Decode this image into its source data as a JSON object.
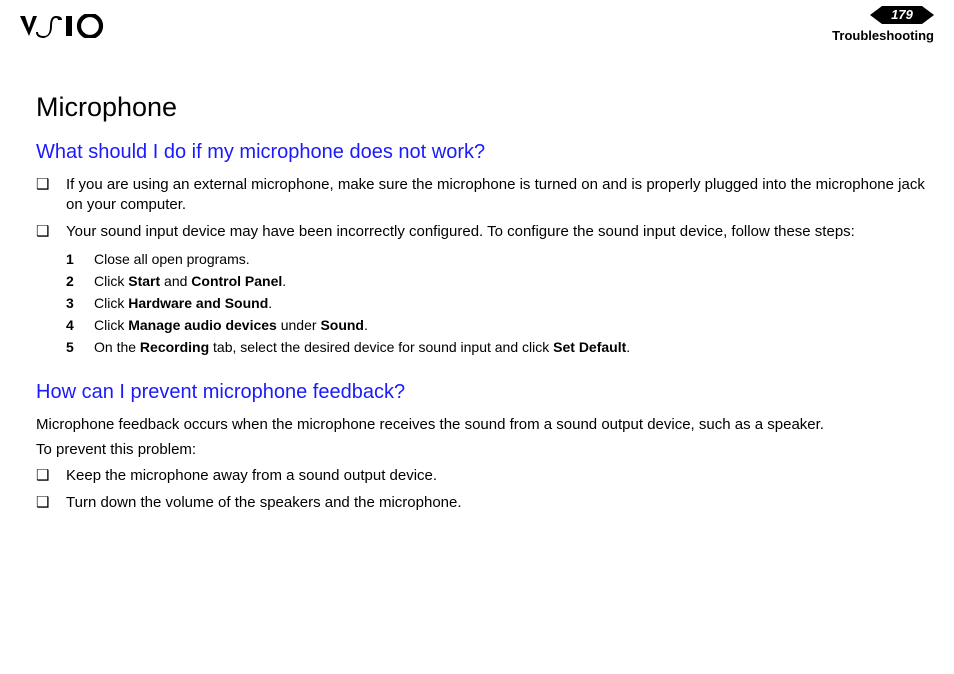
{
  "header": {
    "page_number": "179",
    "section": "Troubleshooting"
  },
  "main": {
    "title": "Microphone",
    "q1": {
      "heading": "What should I do if my microphone does not work?",
      "bullet1": "If you are using an external microphone, make sure the microphone is turned on and is properly plugged into the microphone jack on your computer.",
      "bullet2": "Your sound input device may have been incorrectly configured. To configure the sound input device, follow these steps:",
      "steps": {
        "s1_n": "1",
        "s1": "Close all open programs.",
        "s2_n": "2",
        "s2_pre": "Click ",
        "s2_b1": "Start",
        "s2_mid": " and ",
        "s2_b2": "Control Panel",
        "s2_post": ".",
        "s3_n": "3",
        "s3_pre": "Click ",
        "s3_b1": "Hardware and Sound",
        "s3_post": ".",
        "s4_n": "4",
        "s4_pre": "Click ",
        "s4_b1": "Manage audio devices",
        "s4_mid": " under ",
        "s4_b2": "Sound",
        "s4_post": ".",
        "s5_n": "5",
        "s5_pre": "On the ",
        "s5_b1": "Recording",
        "s5_mid": " tab, select the desired device for sound input and click ",
        "s5_b2": "Set Default",
        "s5_post": "."
      }
    },
    "q2": {
      "heading": "How can I prevent microphone feedback?",
      "p1": "Microphone feedback occurs when the microphone receives the sound from a sound output device, such as a speaker.",
      "p2": "To prevent this problem:",
      "bullet1": "Keep the microphone away from a sound output device.",
      "bullet2": "Turn down the volume of the speakers and the microphone."
    }
  }
}
